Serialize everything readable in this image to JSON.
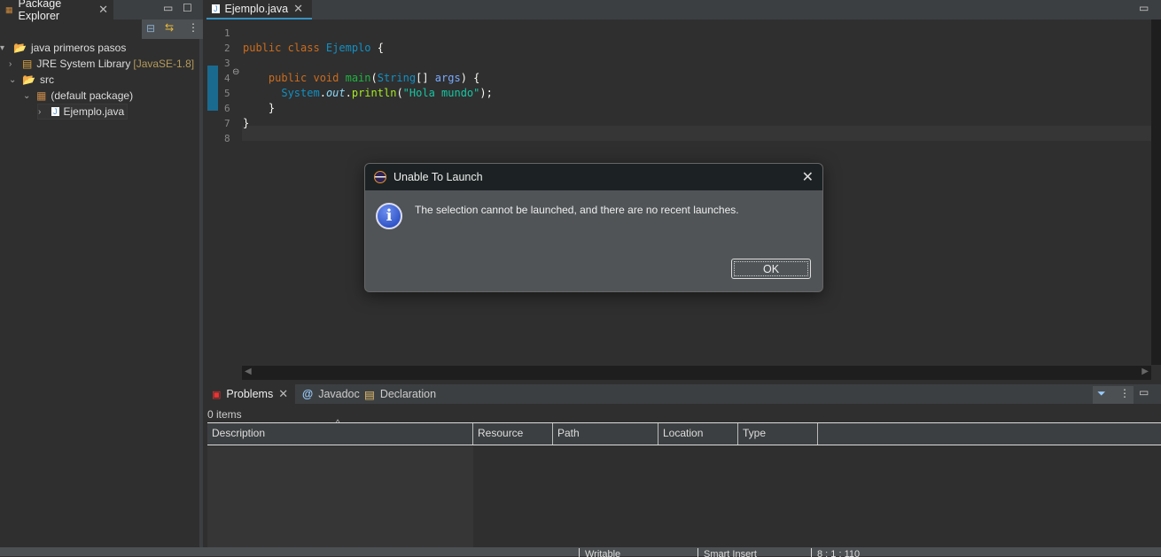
{
  "package_explorer": {
    "tab_label": "Package Explorer",
    "tree": [
      {
        "label": "java primeros pasos",
        "icon": "project-icon"
      },
      {
        "label": "JRE System Library",
        "suffix": "[JavaSE-1.8]",
        "icon": "library-icon"
      },
      {
        "label": "src",
        "icon": "folder-icon"
      },
      {
        "label": "(default package)",
        "icon": "package-icon"
      },
      {
        "label": "Ejemplo.java",
        "icon": "java-file-icon"
      }
    ]
  },
  "editor": {
    "tab_label": "Ejemplo.java",
    "line_numbers": [
      "1",
      "2",
      "3",
      "4",
      "5",
      "6",
      "7",
      "8"
    ],
    "lines": [
      [],
      [
        [
          "kw",
          "public class "
        ],
        [
          "cls",
          "Ejemplo "
        ],
        [
          "pun",
          "{"
        ]
      ],
      [],
      [
        [
          "kw",
          "    public void "
        ],
        [
          "mth",
          "main"
        ],
        [
          "pun",
          "("
        ],
        [
          "cls",
          "String"
        ],
        [
          "pun",
          "[] "
        ],
        [
          "arg",
          "args"
        ],
        [
          "pun",
          ") {"
        ]
      ],
      [
        [
          "cls",
          "      System"
        ],
        [
          "pun",
          "."
        ],
        [
          "fld",
          "out"
        ],
        [
          "pun",
          "."
        ],
        [
          "call",
          "println"
        ],
        [
          "pun",
          "("
        ],
        [
          "str",
          "\"Hola mundo\""
        ],
        [
          "pun",
          ");"
        ]
      ],
      [
        [
          "pun",
          "    }"
        ]
      ],
      [
        [
          "pun",
          "}"
        ]
      ],
      []
    ]
  },
  "problems": {
    "tabs": [
      "Problems",
      "Javadoc",
      "Declaration"
    ],
    "count": "0 items",
    "columns": [
      "Description",
      "Resource",
      "Path",
      "Location",
      "Type"
    ]
  },
  "status_bar": [
    "Writable",
    "Smart Insert",
    "8 : 1 : 110"
  ],
  "dialog": {
    "title": "Unable To Launch",
    "message": "The selection cannot be launched, and there are no recent launches.",
    "ok_label": "OK",
    "icon": "info-icon"
  }
}
